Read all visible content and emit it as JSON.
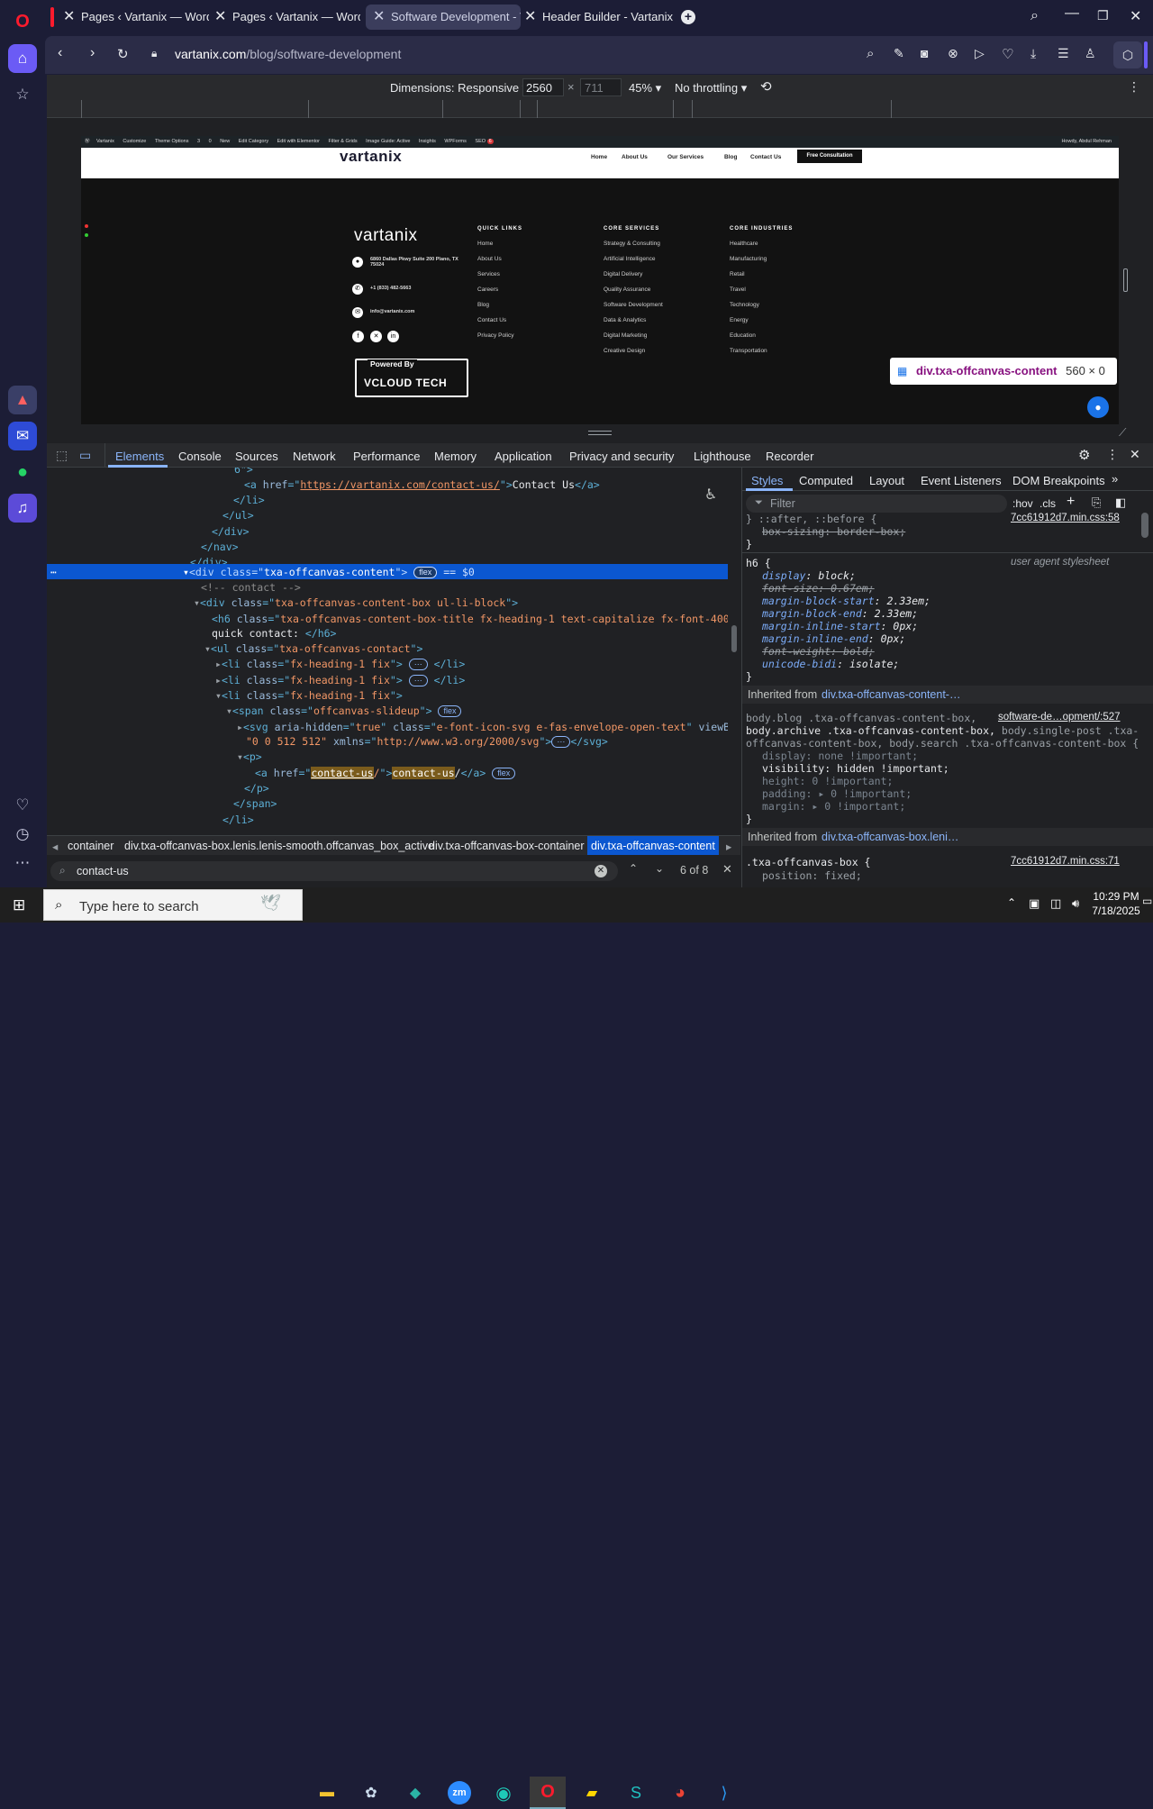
{
  "browser": {
    "tabs": [
      {
        "title": "Pages ‹ Vartanix — WordP",
        "active": false
      },
      {
        "title": "Pages ‹ Vartanix — WordP",
        "active": false
      },
      {
        "title": "Software Development - V",
        "active": true
      },
      {
        "title": "Header Builder - Vartanix",
        "active": false
      }
    ],
    "new_tab": "+",
    "url_host": "vartanix.com",
    "url_path": "/blog/software-development"
  },
  "device_toolbar": {
    "dimensions_label": "Dimensions: Responsive",
    "width": "2560",
    "times": "×",
    "height_placeholder": "711",
    "zoom": "45%",
    "throttling": "No throttling"
  },
  "site": {
    "adminbar": {
      "items": [
        "Vartanix",
        "Customize",
        "Theme Options",
        "3",
        "0",
        "New",
        "Edit Category",
        "Edit with Elementor",
        "Filter & Grids",
        "Image Guide: Active",
        "Insights",
        "WPForms",
        "SEO"
      ],
      "seo_badge": "6",
      "howdy": "Howdy, Abdul Rehman"
    },
    "logo": "vartanix",
    "nav": [
      "Home",
      "About Us",
      "Our Services",
      "Blog",
      "Contact Us"
    ],
    "cta": "Free Consultation",
    "footer": {
      "address": "6860 Dallas Pkwy Suite 200 Plano, TX 75024",
      "phone": "+1 (833) 482-5663",
      "email": "info@vartanix.com",
      "powered_by": "Powered By",
      "powered_brand": "VCLOUD TECH",
      "col1": {
        "title": "QUICK LINKS",
        "links": [
          "Home",
          "About Us",
          "Services",
          "Careers",
          "Blog",
          "Contact Us",
          "Privacy Policy"
        ]
      },
      "col2": {
        "title": "CORE SERVICES",
        "links": [
          "Strategy & Consulting",
          "Artificial Intelligence",
          "Digital Delivery",
          "Quality Assurance",
          "Software Development",
          "Data & Analytics",
          "Digital Marketing",
          "Creative Design"
        ]
      },
      "col3": {
        "title": "CORE INDUSTRIES",
        "links": [
          "Healthcare",
          "Manufacturing",
          "Retail",
          "Travel",
          "Technology",
          "Energy",
          "Education",
          "Transportation"
        ]
      }
    },
    "inspect_tooltip": {
      "selector": "div.txa-offcanvas-content",
      "size": "560 × 0"
    }
  },
  "devtools": {
    "tabs": [
      "Elements",
      "Console",
      "Sources",
      "Network",
      "Performance",
      "Memory",
      "Application",
      "Privacy and security",
      "Lighthouse",
      "Recorder"
    ],
    "active_tab": "Elements",
    "styles_tabs": [
      "Styles",
      "Computed",
      "Layout",
      "Event Listeners",
      "DOM Breakpoints"
    ],
    "filter_placeholder": "Filter",
    "hov": ":hov",
    "cls": ".cls",
    "breadcrumbs": [
      "container",
      "div.txa-offcanvas-box.lenis.lenis-smooth.offcanvas_box_active",
      "div.txa-offcanvas-box-container",
      "div.txa-offcanvas-content"
    ],
    "search_value": "contact-us",
    "search_count": "6 of 8",
    "css": {
      "top_source": "7cc61912d7.min.css:58",
      "top_prop": "box-sizing: border-box;",
      "h6_selector": "h6 {",
      "h6_source": "user agent stylesheet",
      "h6_props": [
        {
          "name": "display",
          "value": "block;",
          "struck": false
        },
        {
          "name": "font-size",
          "value": "0.67em;",
          "struck": true
        },
        {
          "name": "margin-block-start",
          "value": "2.33em;",
          "struck": false
        },
        {
          "name": "margin-block-end",
          "value": "2.33em;",
          "struck": false
        },
        {
          "name": "margin-inline-start",
          "value": "0px;",
          "struck": false
        },
        {
          "name": "margin-inline-end",
          "value": "0px;",
          "struck": false
        },
        {
          "name": "font-weight",
          "value": "bold;",
          "struck": true
        },
        {
          "name": "unicode-bidi",
          "value": "isolate;",
          "struck": false
        }
      ],
      "inherited1_label": "Inherited from",
      "inherited1_link": "div.txa-offcanvas-content-…",
      "rule2_source": "software-de…opment/:527",
      "rule2_selector_l1": "body.blog .txa-offcanvas-content-box,",
      "rule2_selector_l2": "body.archive .txa-offcanvas-content-box,",
      "rule2_selector_l2b": "body.single-post .txa-",
      "rule2_selector_l3": "offcanvas-content-box, body.search .txa-offcanvas-content-box {",
      "rule2_props": [
        {
          "name": "display",
          "value": "none !important;"
        },
        {
          "name": "visibility",
          "value": "hidden !important;"
        },
        {
          "name": "height",
          "value": "0 !important;"
        },
        {
          "name": "padding",
          "value": "▸ 0 !important;"
        },
        {
          "name": "margin",
          "value": "▸ 0 !important;"
        }
      ],
      "inherited2_link": "div.txa-offcanvas-box.leni…",
      "rule3_selector": ".txa-offcanvas-box {",
      "rule3_source": "7cc61912d7.min.css:71",
      "rule3_prop": "position: fixed;"
    },
    "dom": [
      "6\">",
      "<a href=\"https://vartanix.com/contact-us/\">Contact Us</a>",
      "</li>",
      "</ul>",
      "</div>",
      "</nav>",
      "</div>",
      "<div class=\"txa-offcanvas-content\">",
      "<!-- contact -->",
      "<div class=\"txa-offcanvas-content-box  ul-li-block\">",
      "<h6 class=\"txa-offcanvas-content-box-title fx-heading-1 text-capitalize fx-font-400\">",
      "quick contact: </h6>",
      "<ul class=\"txa-offcanvas-contact\">",
      "<li class=\"fx-heading-1 fix\">",
      "<li class=\"fx-heading-1 fix\">",
      "<li class=\"fx-heading-1 fix\">",
      "<span class=\"offcanvas-slideup\">",
      "<svg aria-hidden=\"true\" class=\"e-font-icon-svg e-fas-envelope-open-text\" viewBox=",
      "\"0 0 512 512\" xmlns=\"http://www.w3.org/2000/svg\">",
      "<p>",
      "<a href=\"contact-us/\">contact-us/</a>",
      "</p>",
      "</span>",
      "</li>"
    ],
    "flex_badge": "flex",
    "dollar0": "== $0"
  },
  "taskbar": {
    "search_placeholder": "Type here to search",
    "time": "10:29 PM",
    "date": "7/18/2025"
  }
}
